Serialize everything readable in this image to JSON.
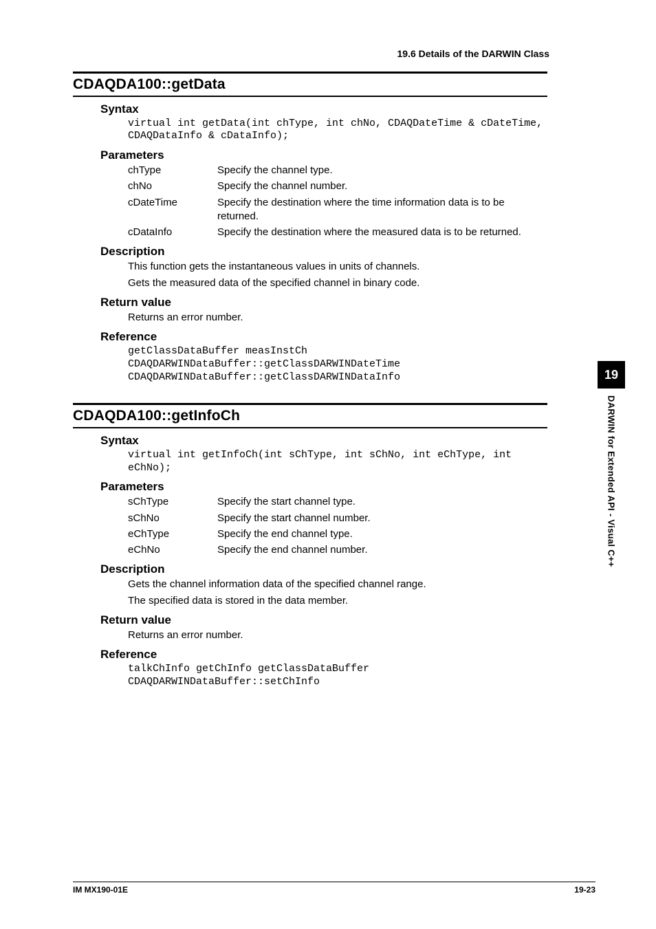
{
  "header": {
    "running": "19.6  Details of the DARWIN Class"
  },
  "sidebar": {
    "chapter": "19",
    "label": "DARWIN for Extended API - Visual C++"
  },
  "sections": [
    {
      "title": "CDAQDA100::getData",
      "syntax_label": "Syntax",
      "syntax_code": "virtual int getData(int chType, int chNo, CDAQDateTime & cDateTime, CDAQDataInfo & cDataInfo);",
      "parameters_label": "Parameters",
      "parameters": [
        {
          "name": "chType",
          "desc": "Specify the channel type."
        },
        {
          "name": "chNo",
          "desc": "Specify the channel number."
        },
        {
          "name": "cDateTime",
          "desc": "Specify the destination where the time information data is to be returned."
        },
        {
          "name": "cDataInfo",
          "desc": "Specify the destination where the measured data is to be returned."
        }
      ],
      "description_label": "Description",
      "description": [
        "This function gets the instantaneous values in units of channels.",
        "Gets the measured data of the specified channel in binary code."
      ],
      "return_label": "Return value",
      "return_text": "Returns an error number.",
      "reference_label": "Reference",
      "reference_code": "getClassDataBuffer measInstCh\nCDAQDARWINDataBuffer::getClassDARWINDateTime\nCDAQDARWINDataBuffer::getClassDARWINDataInfo"
    },
    {
      "title": "CDAQDA100::getInfoCh",
      "syntax_label": "Syntax",
      "syntax_code": "virtual int getInfoCh(int sChType, int sChNo, int eChType, int eChNo);",
      "parameters_label": "Parameters",
      "parameters": [
        {
          "name": "sChType",
          "desc": "Specify the start channel type."
        },
        {
          "name": "sChNo",
          "desc": "Specify the start channel number."
        },
        {
          "name": "eChType",
          "desc": "Specify the end channel type."
        },
        {
          "name": "eChNo",
          "desc": "Specify the end channel number."
        }
      ],
      "description_label": "Description",
      "description": [
        "Gets the channel information data of the specified channel range.",
        "The specified data is stored in the data member."
      ],
      "return_label": "Return value",
      "return_text": "Returns an error number.",
      "reference_label": "Reference",
      "reference_code": "talkChInfo getChInfo getClassDataBuffer\nCDAQDARWINDataBuffer::setChInfo"
    }
  ],
  "footer": {
    "left": "IM MX190-01E",
    "right": "19-23"
  }
}
